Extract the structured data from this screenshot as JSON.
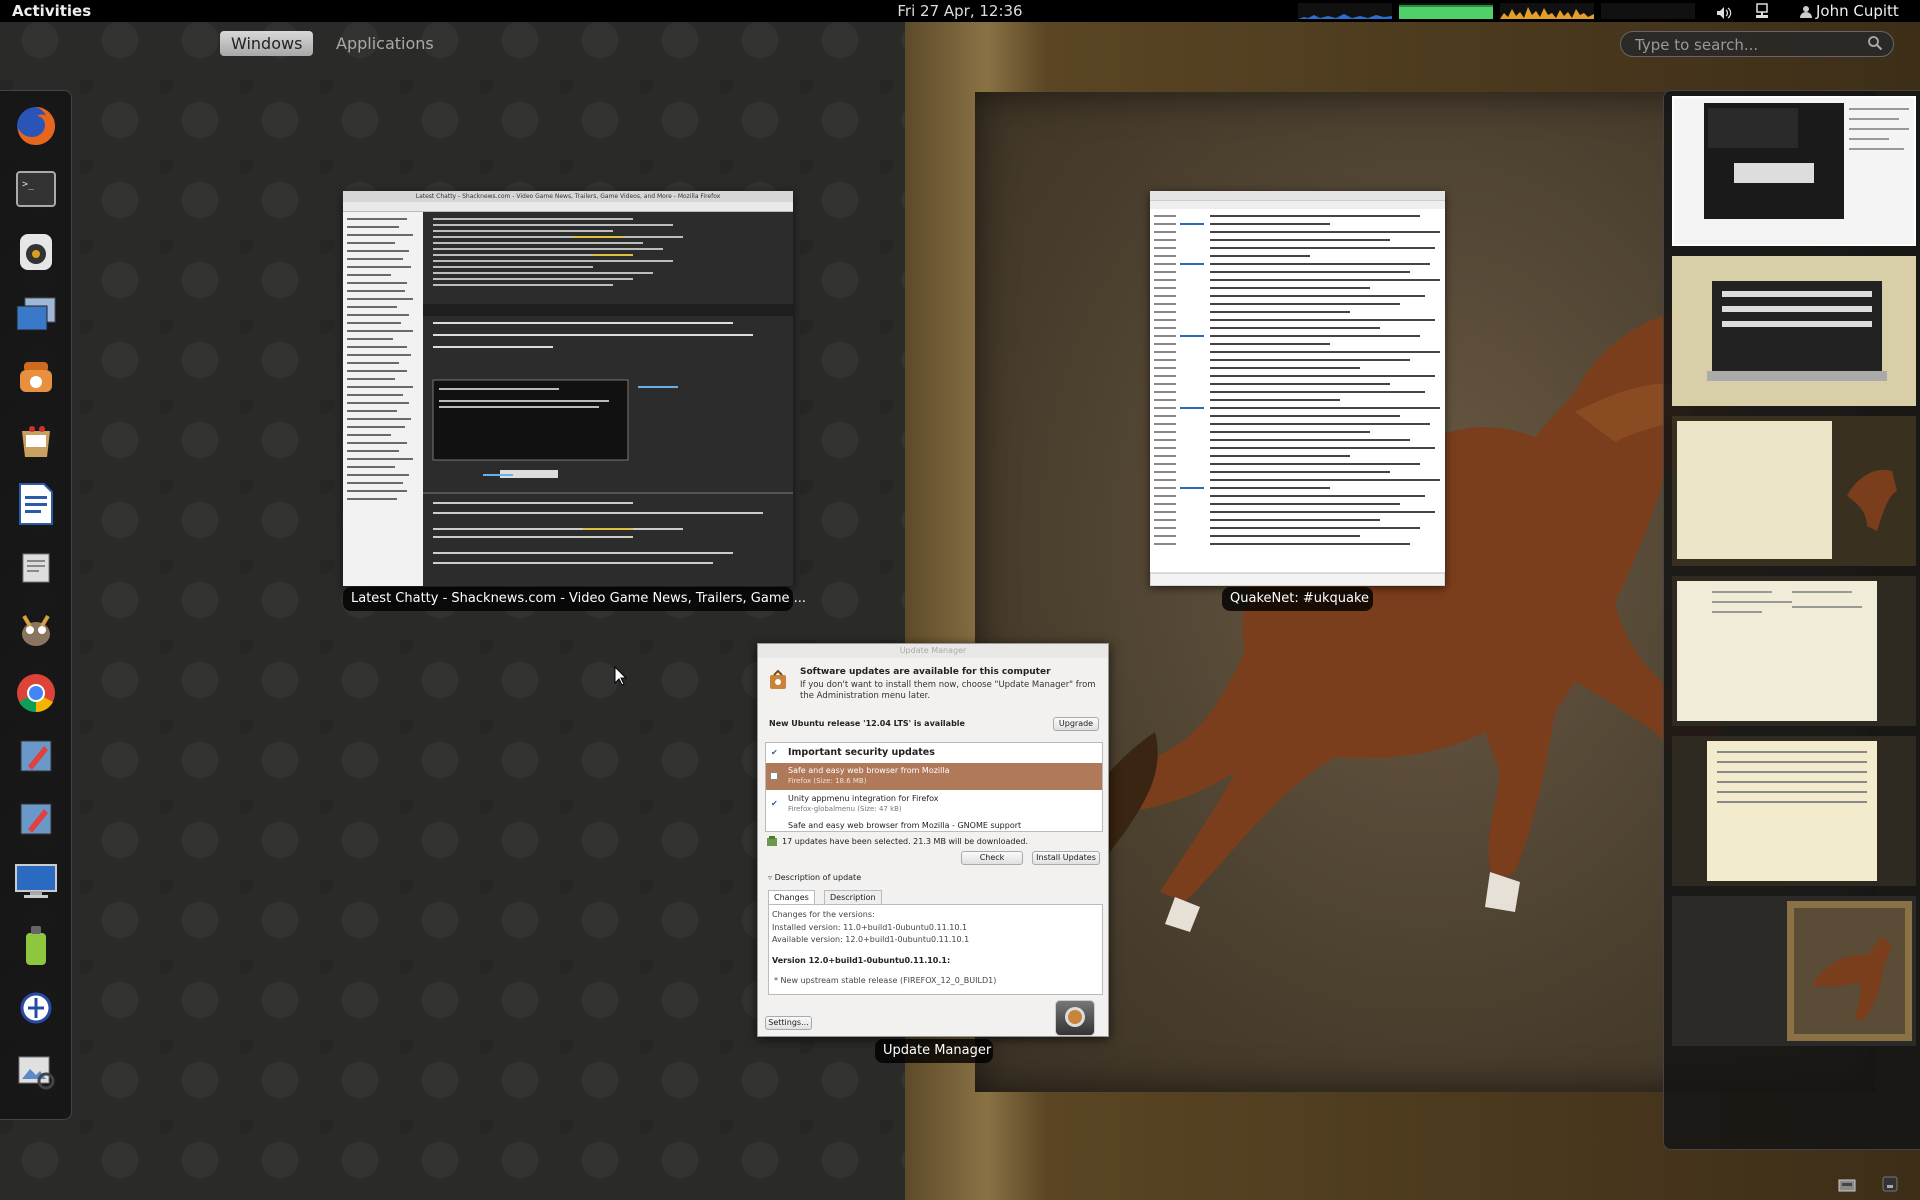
{
  "top_panel": {
    "activities": "Activities",
    "clock": "Fri 27 Apr, 12:36",
    "user": "John Cupitt",
    "icons": [
      "volume-icon",
      "network-icon",
      "user-status-icon"
    ]
  },
  "overview": {
    "tabs": [
      {
        "label": "Windows",
        "active": true
      },
      {
        "label": "Applications",
        "active": false
      }
    ],
    "search": {
      "placeholder": "Type to search...",
      "value": ""
    }
  },
  "dash": {
    "apps": [
      "firefox-icon",
      "terminal-icon",
      "rhythmbox-icon",
      "screenshot-icon",
      "transmission-icon",
      "software-center-icon",
      "libreoffice-writer-icon",
      "text-editor-icon",
      "gimp-icon",
      "chrome-icon",
      "inkscape-icon",
      "inkscape-alt-icon",
      "remote-desktop-icon",
      "android-icon",
      "zotero-icon",
      "image-viewer-icon"
    ]
  },
  "windows": {
    "firefox": {
      "caption": "Latest Chatty - Shacknews.com - Video Game News, Trailers, Game ...",
      "inner_title": "Latest Chatty - Shacknews.com - Video Game News, Trailers, Game Videos, and More - Mozilla Firefox"
    },
    "quakenet": {
      "caption": "QuakeNet: #ukquake"
    },
    "update_manager": {
      "caption": "Update Manager",
      "title": "Update Manager",
      "heading": "Software updates are available for this computer",
      "subheading": "If you don't want to install them now, choose \"Update Manager\" from the Administration menu later.",
      "release_notice": "New Ubuntu release '12.04 LTS' is available",
      "upgrade_button": "Upgrade",
      "list_header": "Important security updates",
      "updates": [
        {
          "name": "Safe and easy web browser from Mozilla",
          "detail": "Firefox (Size: 18.6 MB)",
          "selected": true
        },
        {
          "name": "Unity appmenu integration for Firefox",
          "detail": "Firefox-globalmenu (Size: 47 kB)",
          "selected": false
        },
        {
          "name": "Safe and easy web browser from Mozilla - GNOME support",
          "detail": "",
          "selected": false
        }
      ],
      "summary": "17 updates have been selected. 21.3 MB will be downloaded.",
      "check_button": "Check",
      "install_button": "Install Updates",
      "description_expander": "Description of update",
      "tabs": [
        "Changes",
        "Description"
      ],
      "changes": {
        "line1": "Changes for the versions:",
        "line2": "Installed version: 11.0+build1-0ubuntu0.11.10.1",
        "line3": "Available version: 12.0+build1-0ubuntu0.11.10.1",
        "version_heading": "Version 12.0+build1-0ubuntu0.11.10.1:",
        "bullet": "* New upstream stable release (FIREFOX_12_0_BUILD1)"
      },
      "settings_button": "Settings..."
    }
  },
  "colors": {
    "panel": "#000000",
    "accent_selection": "#b07a5a",
    "cpu_graph": "#2a6fd1",
    "mem_graph": "#4fd06a",
    "net_graph": "#e2a02b"
  }
}
